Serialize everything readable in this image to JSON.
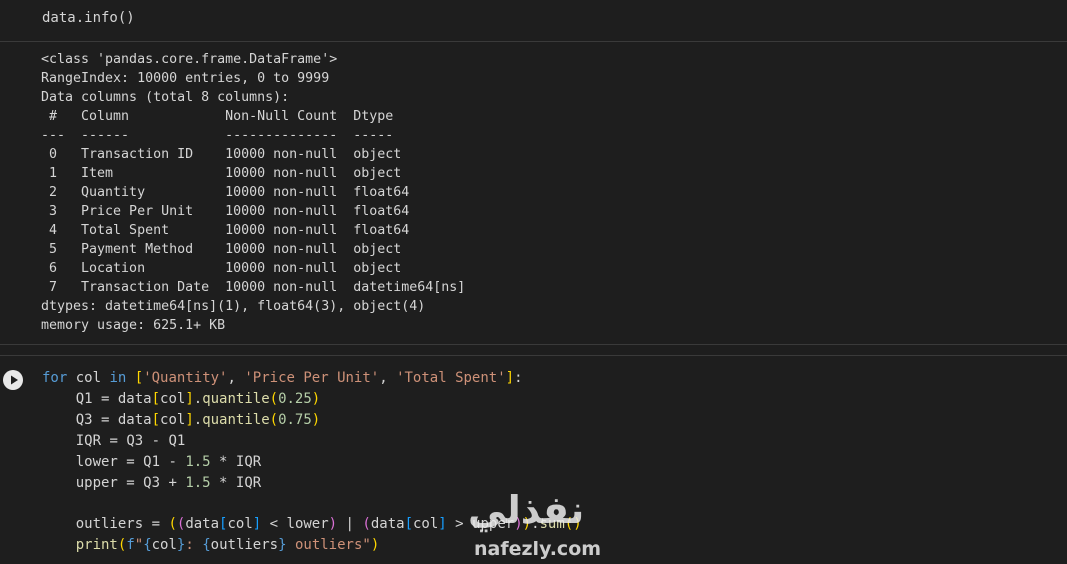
{
  "cell1": {
    "code": "data.info()"
  },
  "output1": {
    "lines": [
      "<class 'pandas.core.frame.DataFrame'>",
      "RangeIndex: 10000 entries, 0 to 9999",
      "Data columns (total 8 columns):",
      " #   Column            Non-Null Count  Dtype",
      "---  ------            --------------  -----",
      " 0   Transaction ID    10000 non-null  object",
      " 1   Item              10000 non-null  object",
      " 2   Quantity          10000 non-null  float64",
      " 3   Price Per Unit    10000 non-null  float64",
      " 4   Total Spent       10000 non-null  float64",
      " 5   Payment Method    10000 non-null  object",
      " 6   Location          10000 non-null  object",
      " 7   Transaction Date  10000 non-null  datetime64[ns]",
      "dtypes: datetime64[ns](1), float64(3), object(4)",
      "memory usage: 625.1+ KB"
    ]
  },
  "cell2": {
    "run_icon": "play-icon",
    "tokens": {
      "for": "for",
      "col": "col",
      "in": "in",
      "q1_str": "'Quantity'",
      "ppu_str": "'Price Per Unit'",
      "ts_str": "'Total Spent'",
      "Q1": "Q1",
      "Q3": "Q3",
      "IQR": "IQR",
      "lower": "lower",
      "upper": "upper",
      "data": "data",
      "quantile": "quantile",
      "n025": "0.25",
      "n075": "0.75",
      "n15": "1.5",
      "outliers": "outliers",
      "sum": "sum",
      "print": "print",
      "f": "f",
      "fstr_open": "\"",
      "fstr_text": " outliers\"",
      "colon_sep": ": "
    }
  },
  "watermark": {
    "arabic": "نفذلي",
    "latin": "nafezly.com"
  },
  "colors": {
    "background": "#1e1e1e",
    "keyword": "#569cd6",
    "function": "#dcdcaa",
    "string": "#ce9178",
    "number": "#b5cea8"
  }
}
